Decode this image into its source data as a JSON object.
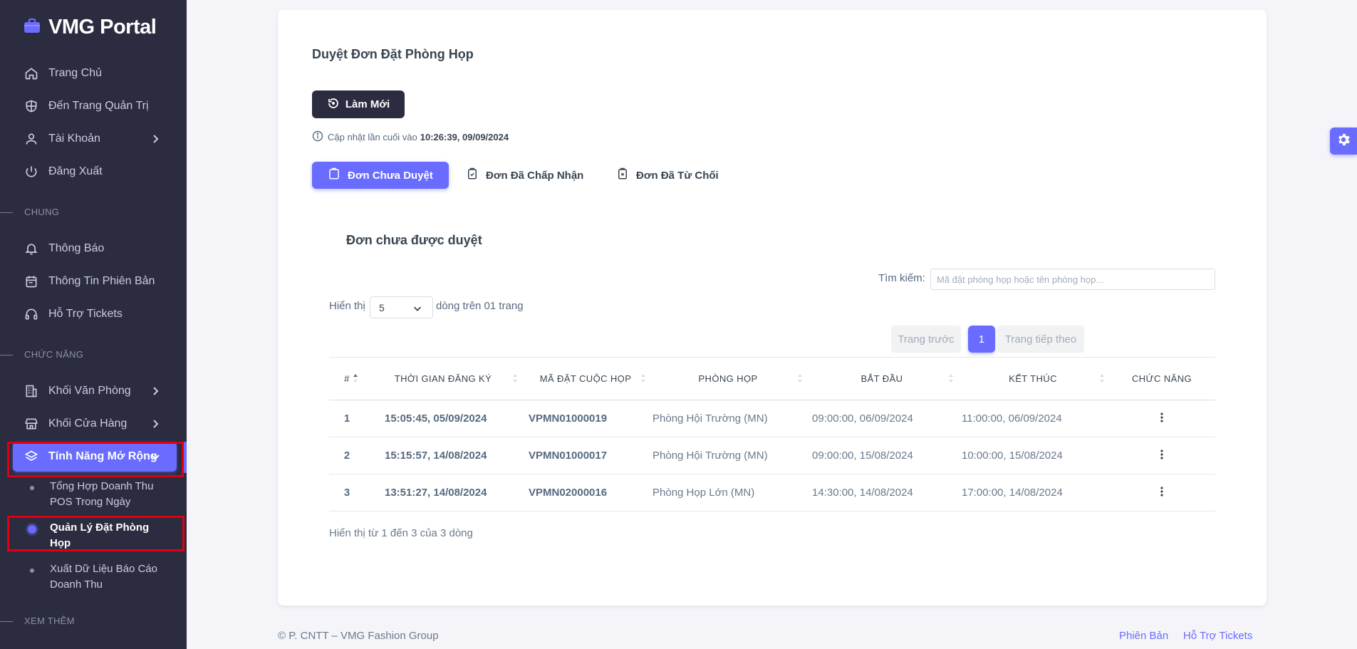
{
  "brand": {
    "name": "VMG Portal"
  },
  "sidebar": {
    "items": [
      {
        "label": "Trang Chủ"
      },
      {
        "label": "Đến Trang Quản Trị"
      },
      {
        "label": "Tài Khoản"
      },
      {
        "label": "Đăng Xuất"
      }
    ],
    "section_general": "CHUNG",
    "general_items": [
      {
        "label": "Thông Báo"
      },
      {
        "label": "Thông Tin Phiên Bản"
      },
      {
        "label": "Hỗ Trợ Tickets"
      }
    ],
    "section_features": "CHỨC NĂNG",
    "feature_items": [
      {
        "label": "Khối Văn Phòng"
      },
      {
        "label": "Khối Cửa Hàng"
      },
      {
        "label": "Tính Năng Mở Rộng"
      }
    ],
    "sub_items": [
      {
        "label": "Tổng Hợp Doanh Thu POS Trong Ngày"
      },
      {
        "label": "Quản Lý Đặt Phòng Họp"
      },
      {
        "label": "Xuất Dữ Liệu Báo Cáo Doanh Thu"
      }
    ],
    "section_more": "XEM THÊM"
  },
  "main": {
    "title": "Duyệt Đơn Đặt Phòng Họp",
    "refresh_label": "Làm Mới",
    "last_updated_prefix": "Cập nhật lần cuối vào",
    "last_updated_value": "10:26:39, 09/09/2024",
    "tabs": [
      {
        "label": "Đơn Chưa Duyệt"
      },
      {
        "label": "Đơn Đã Chấp Nhận"
      },
      {
        "label": "Đơn Đã Từ Chối"
      }
    ],
    "subtitle": "Đơn chưa được duyệt",
    "search_label": "Tìm kiếm:",
    "search_placeholder": "Mã đặt phòng họp hoặc tên phòng họp...",
    "show_label": "Hiển thị",
    "page_size": "5",
    "rows_per_page_text": "dòng trên 01 trang",
    "pager": {
      "prev": "Trang trước",
      "current": "1",
      "next": "Trang tiếp theo"
    },
    "columns": [
      "#",
      "THỜI GIAN ĐĂNG KÝ",
      "MÃ ĐẶT CUỘC HỌP",
      "PHÒNG HỌP",
      "BẮT ĐẦU",
      "KẾT THÚC",
      "CHỨC NĂNG"
    ],
    "rows": [
      {
        "no": "1",
        "registered": "15:05:45, 05/09/2024",
        "code": "VPMN01000019",
        "room": "Phòng Hội Trường (MN)",
        "start": "09:00:00, 06/09/2024",
        "end": "11:00:00, 06/09/2024"
      },
      {
        "no": "2",
        "registered": "15:15:57, 14/08/2024",
        "code": "VPMN01000017",
        "room": "Phòng Hội Trường (MN)",
        "start": "09:00:00, 15/08/2024",
        "end": "10:00:00, 15/08/2024"
      },
      {
        "no": "3",
        "registered": "13:51:27, 14/08/2024",
        "code": "VPMN02000016",
        "room": "Phòng Họp Lớn (MN)",
        "start": "14:30:00, 14/08/2024",
        "end": "17:00:00, 14/08/2024"
      }
    ],
    "table_info": "Hiển thị từ 1 đến 3 của 3 dòng"
  },
  "footer": {
    "copyright": "© P. CNTT – VMG Fashion Group",
    "links": [
      {
        "label": "Phiên Bản"
      },
      {
        "label": "Hỗ Trợ Tickets"
      }
    ]
  },
  "colors": {
    "primary": "#696cff",
    "sidebar_bg": "#2b2c40",
    "highlight_red": "#e0000f",
    "page_bg": "#f5f5f9"
  },
  "icons": [
    "briefcase-icon",
    "home-icon",
    "shield-icon",
    "user-icon",
    "power-icon",
    "bell-icon",
    "calendar-icon",
    "headset-icon",
    "building-icon",
    "store-icon",
    "layers-icon",
    "chevron-right-icon",
    "chevron-down-icon",
    "refresh-icon",
    "info-icon",
    "clipboard-icon",
    "clipboard-check-icon",
    "clipboard-x-icon",
    "more-vertical-icon",
    "gear-icon"
  ]
}
